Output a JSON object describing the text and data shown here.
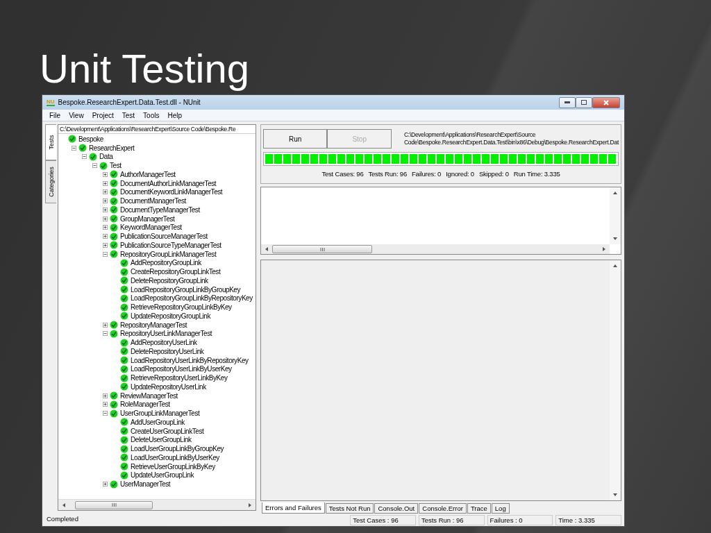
{
  "slide": {
    "title": "Unit Testing"
  },
  "window": {
    "title": "Bespoke.ResearchExpert.Data.Test.dll - NUnit",
    "logo": "NU"
  },
  "menu": [
    "File",
    "View",
    "Project",
    "Test",
    "Tools",
    "Help"
  ],
  "side_tabs": [
    {
      "label": "Tests",
      "selected": true
    },
    {
      "label": "Categories",
      "selected": false
    }
  ],
  "tree": {
    "path": "C:\\Development\\Applications\\ResearchExpert\\Source Code\\Bespoke.Re",
    "nodes": [
      {
        "name": "Bespoke",
        "children": [
          {
            "name": "ResearchExpert",
            "expanded": true,
            "children": [
              {
                "name": "Data",
                "expanded": true,
                "children": [
                  {
                    "name": "Test",
                    "expanded": true,
                    "children": [
                      {
                        "name": "AuthorManagerTest",
                        "expanded": false
                      },
                      {
                        "name": "DocumentAuthorLinkManagerTest",
                        "expanded": false
                      },
                      {
                        "name": "DocumentKeywordLinkManagerTest",
                        "expanded": false
                      },
                      {
                        "name": "DocumentManagerTest",
                        "expanded": false
                      },
                      {
                        "name": "DocumentTypeManagerTest",
                        "expanded": false
                      },
                      {
                        "name": "GroupManagerTest",
                        "expanded": false
                      },
                      {
                        "name": "KeywordManagerTest",
                        "expanded": false
                      },
                      {
                        "name": "PublicationSourceManagerTest",
                        "expanded": false
                      },
                      {
                        "name": "PublicationSourceTypeManagerTest",
                        "expanded": false
                      },
                      {
                        "name": "RepositoryGroupLinkManagerTest",
                        "expanded": true,
                        "children": [
                          {
                            "name": "AddRepositoryGroupLink"
                          },
                          {
                            "name": "CreateRepositoryGroupLinkTest"
                          },
                          {
                            "name": "DeleteRepositoryGroupLink"
                          },
                          {
                            "name": "LoadRepositoryGroupLinkByGroupKey"
                          },
                          {
                            "name": "LoadRepositoryGroupLinkByRepositoryKey"
                          },
                          {
                            "name": "RetrieveRepositoryGroupLinkByKey"
                          },
                          {
                            "name": "UpdateRepositoryGroupLink"
                          }
                        ]
                      },
                      {
                        "name": "RepositoryManagerTest",
                        "expanded": false
                      },
                      {
                        "name": "RepositoryUserLinkManagerTest",
                        "expanded": true,
                        "children": [
                          {
                            "name": "AddRepositoryUserLink"
                          },
                          {
                            "name": "DeleteRepositoryUserLink"
                          },
                          {
                            "name": "LoadRepositoryUserLinkByRepositoryKey"
                          },
                          {
                            "name": "LoadRepositoryUserLinkByUserKey"
                          },
                          {
                            "name": "RetrieveRepositoryUserLinkByKey"
                          },
                          {
                            "name": "UpdateRepositoryUserLink"
                          }
                        ]
                      },
                      {
                        "name": "ReviewManagerTest",
                        "expanded": false
                      },
                      {
                        "name": "RoleManagerTest",
                        "expanded": false
                      },
                      {
                        "name": "UserGroupLinkManagerTest",
                        "expanded": true,
                        "children": [
                          {
                            "name": "AddUserGroupLink"
                          },
                          {
                            "name": "CreateUserGroupLinkTest"
                          },
                          {
                            "name": "DeleteUserGroupLink"
                          },
                          {
                            "name": "LoadUserGroupLinkByGroupKey"
                          },
                          {
                            "name": "LoadUserGroupLinkByUserKey"
                          },
                          {
                            "name": "RetrieveUserGroupLinkByKey"
                          },
                          {
                            "name": "UpdateUserGroupLink"
                          }
                        ]
                      },
                      {
                        "name": "UserManagerTest",
                        "expanded": false
                      }
                    ]
                  }
                ]
              }
            ]
          }
        ]
      }
    ]
  },
  "run_panel": {
    "buttons": [
      {
        "label": "Run",
        "disabled": false
      },
      {
        "label": "Stop",
        "disabled": true
      }
    ],
    "path_lines": [
      "C:\\Development\\Applications\\ResearchExpert\\Source",
      "Code\\Bespoke.ResearchExpert.Data.Test\\bin\\x86\\Debug\\Bespoke.ResearchExpert.Dat"
    ],
    "progress": {
      "level": 1
    },
    "stats": [
      "Test Cases: 96",
      "Tests Run: 96",
      "Failures: 0",
      "Ignored: 0",
      "Skipped: 0",
      "Run Time: 3.335"
    ]
  },
  "result_tabs": [
    {
      "label": "Errors and Failures",
      "selected": true
    },
    {
      "label": "Tests Not Run",
      "selected": false
    },
    {
      "label": "Console.Out",
      "selected": false
    },
    {
      "label": "Console.Error",
      "selected": false
    },
    {
      "label": "Trace",
      "selected": false
    },
    {
      "label": "Log",
      "selected": false
    }
  ],
  "status_bar": {
    "message": "Completed",
    "panels": [
      "Test Cases : 96",
      "Tests Run : 96",
      "Failures : 0",
      "Time : 3.335"
    ]
  }
}
